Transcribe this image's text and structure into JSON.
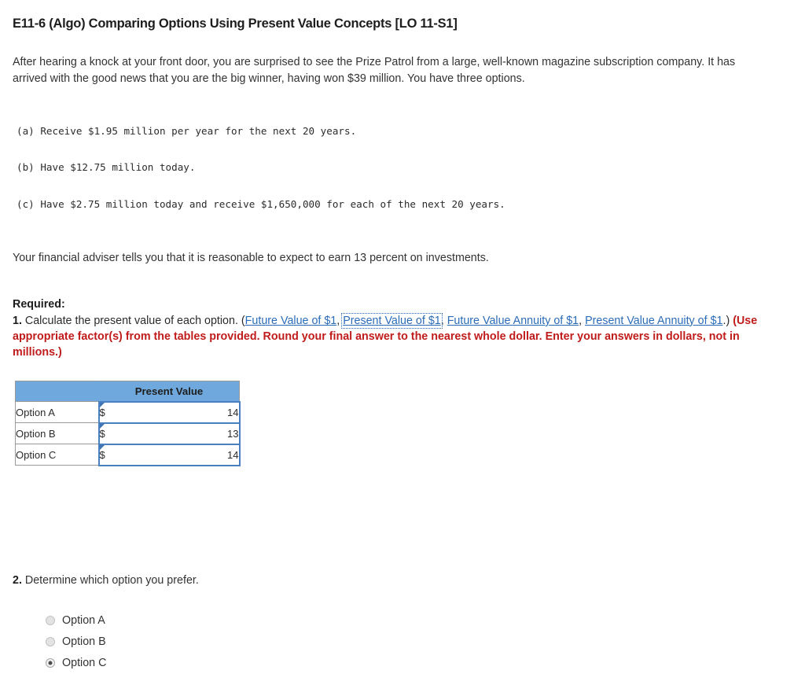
{
  "title": "E11-6 (Algo) Comparing Options Using Present Value Concepts [LO 11-S1]",
  "intro": "After hearing a knock at your front door, you are surprised to see the Prize Patrol from a large, well-known magazine subscription company. It has arrived with the good news that you are the big winner, having won $39 million. You have three options.",
  "options_mono": [
    "(a) Receive $1.95 million per year for the next 20 years.",
    "(b) Have $12.75 million today.",
    "(c) Have $2.75 million today and receive $1,650,000 for each of the next 20 years."
  ],
  "adviser_note": "Your financial adviser tells you that it is reasonable to expect to earn 13 percent on investments.",
  "required": {
    "label": "Required:",
    "item1_number": "1.",
    "item1_text_before": " Calculate the present value of each option. (",
    "links": [
      {
        "label": "Future Value of $1",
        "focused": false
      },
      {
        "label": "Present Value of $1",
        "focused": true
      },
      {
        "label": "Future Value Annuity of $1",
        "focused": false
      },
      {
        "label": "Present Value Annuity of $1",
        "focused": false
      }
    ],
    "separator": ", ",
    "close_paren": ".) ",
    "red_instruction": "(Use appropriate factor(s) from the tables provided. Round your final answer to the nearest whole dollar. Enter your answers in dollars, not in millions.)"
  },
  "table": {
    "header_blank": "",
    "header_value": "Present Value",
    "rows": [
      {
        "label": "Option A",
        "currency": "$",
        "value": "14"
      },
      {
        "label": "Option B",
        "currency": "$",
        "value": "13"
      },
      {
        "label": "Option C",
        "currency": "$",
        "value": "14"
      }
    ]
  },
  "part2": {
    "number": "2.",
    "text": " Determine which option you prefer.",
    "choices": [
      {
        "label": "Option A",
        "selected": false
      },
      {
        "label": "Option B",
        "selected": false
      },
      {
        "label": "Option C",
        "selected": true
      }
    ]
  },
  "colors": {
    "link": "#2b6cb8",
    "red": "#c01c1c",
    "table_header_blue": "#6fa8dc",
    "cell_border_blue": "#4a80c0"
  }
}
